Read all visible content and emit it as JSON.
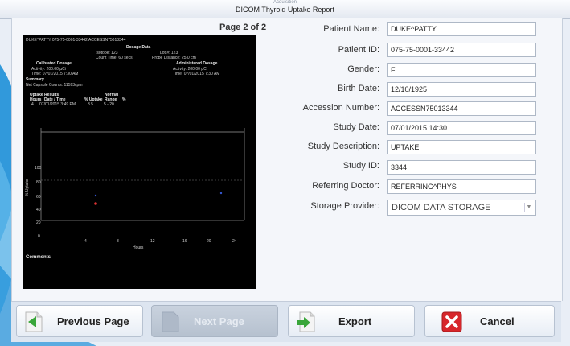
{
  "window": {
    "app_name": "Acquisition",
    "title": "DICOM Thyroid Uptake Report"
  },
  "preview": {
    "page_indicator": "Page 2 of 2",
    "header_line": "DUKE^PATTY  075-75-0001-33442  ACCESSN75013344",
    "dosage_data_title": "Dosage Data",
    "isotope": "Isotope:    123",
    "lot": "Lot #: 123",
    "count_time": "Count Time: 60 secs",
    "probe_distance": "Probe Distance: 25.0 cm",
    "calibrated_title": "Calibrated Dosage",
    "administered_title": "Administered Dosage",
    "cal_activity": "Activity: 200.00 µCi",
    "cal_time": "Time:   07/01/2015 7:30 AM",
    "adm_activity": "Activity: 200.00 µCi",
    "adm_time": "Time:   07/01/2015 7:30 AM",
    "summary_title": "Summary",
    "net_counts": "Net Capsule Counts: 11593cpm",
    "uptake_title": "Uptake Results",
    "normal_title": "Normal",
    "col_hours": "Hours",
    "col_datetime": "Date / Time",
    "col_uptake": "% Uptake",
    "col_range": "Range",
    "col_pct": "%",
    "row_hours": "4",
    "row_datetime": "07/01/2015 3:49 PM",
    "row_uptake": "3.5",
    "row_range": "5 - 20",
    "comments": "Comments",
    "y_label": "% Uptake",
    "x_label": "Hours",
    "chart_y_ticks": [
      "100",
      "80",
      "60",
      "40",
      "20",
      "0"
    ],
    "chart_x_ticks": [
      "4",
      "8",
      "12",
      "16",
      "20",
      "24"
    ]
  },
  "form": {
    "patient_name_label": "Patient Name:",
    "patient_name": "DUKE^PATTY",
    "patient_id_label": "Patient ID:",
    "patient_id": "075-75-0001-33442",
    "gender_label": "Gender:",
    "gender": "F",
    "birth_date_label": "Birth Date:",
    "birth_date": "12/10/1925",
    "accession_label": "Accession Number:",
    "accession": "ACCESSN75013344",
    "study_date_label": "Study Date:",
    "study_date": "07/01/2015 14:30",
    "study_desc_label": "Study Description:",
    "study_desc": "UPTAKE",
    "study_id_label": "Study ID:",
    "study_id": "3344",
    "referring_label": "Referring Doctor:",
    "referring": "REFERRING^PHYS",
    "storage_label": "Storage Provider:",
    "storage": "DICOM DATA STORAGE"
  },
  "buttons": {
    "previous": "Previous Page",
    "next": "Next Page",
    "export": "Export",
    "cancel": "Cancel"
  },
  "colors": {
    "accent_green": "#3aa63a",
    "cancel_red": "#d7262b",
    "swoosh_blue": "#1d8fd8"
  }
}
